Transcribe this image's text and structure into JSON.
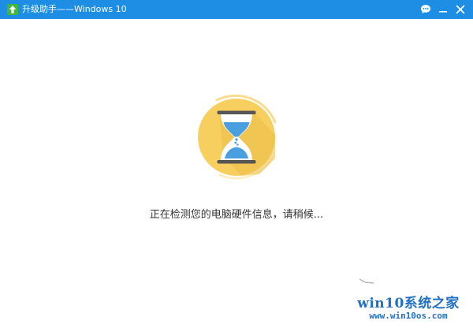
{
  "window": {
    "title": "升级助手——Windows 10",
    "titlebar_color": "#1d8ee4",
    "app_icon": "upgrade-arrow-icon",
    "controls": {
      "feedback_icon": "chat-bubble-icon",
      "minimize_icon": "minimize-icon",
      "close_icon": "close-icon"
    }
  },
  "main": {
    "loading_icon": "hourglass-icon",
    "accent_color": "#f7cf5e",
    "status_text": "正在检测您的电脑硬件信息，请稍候..."
  },
  "watermark": {
    "line1": "win10系统之家",
    "line2": "www.win10os.com",
    "color": "#1f6fc8"
  }
}
